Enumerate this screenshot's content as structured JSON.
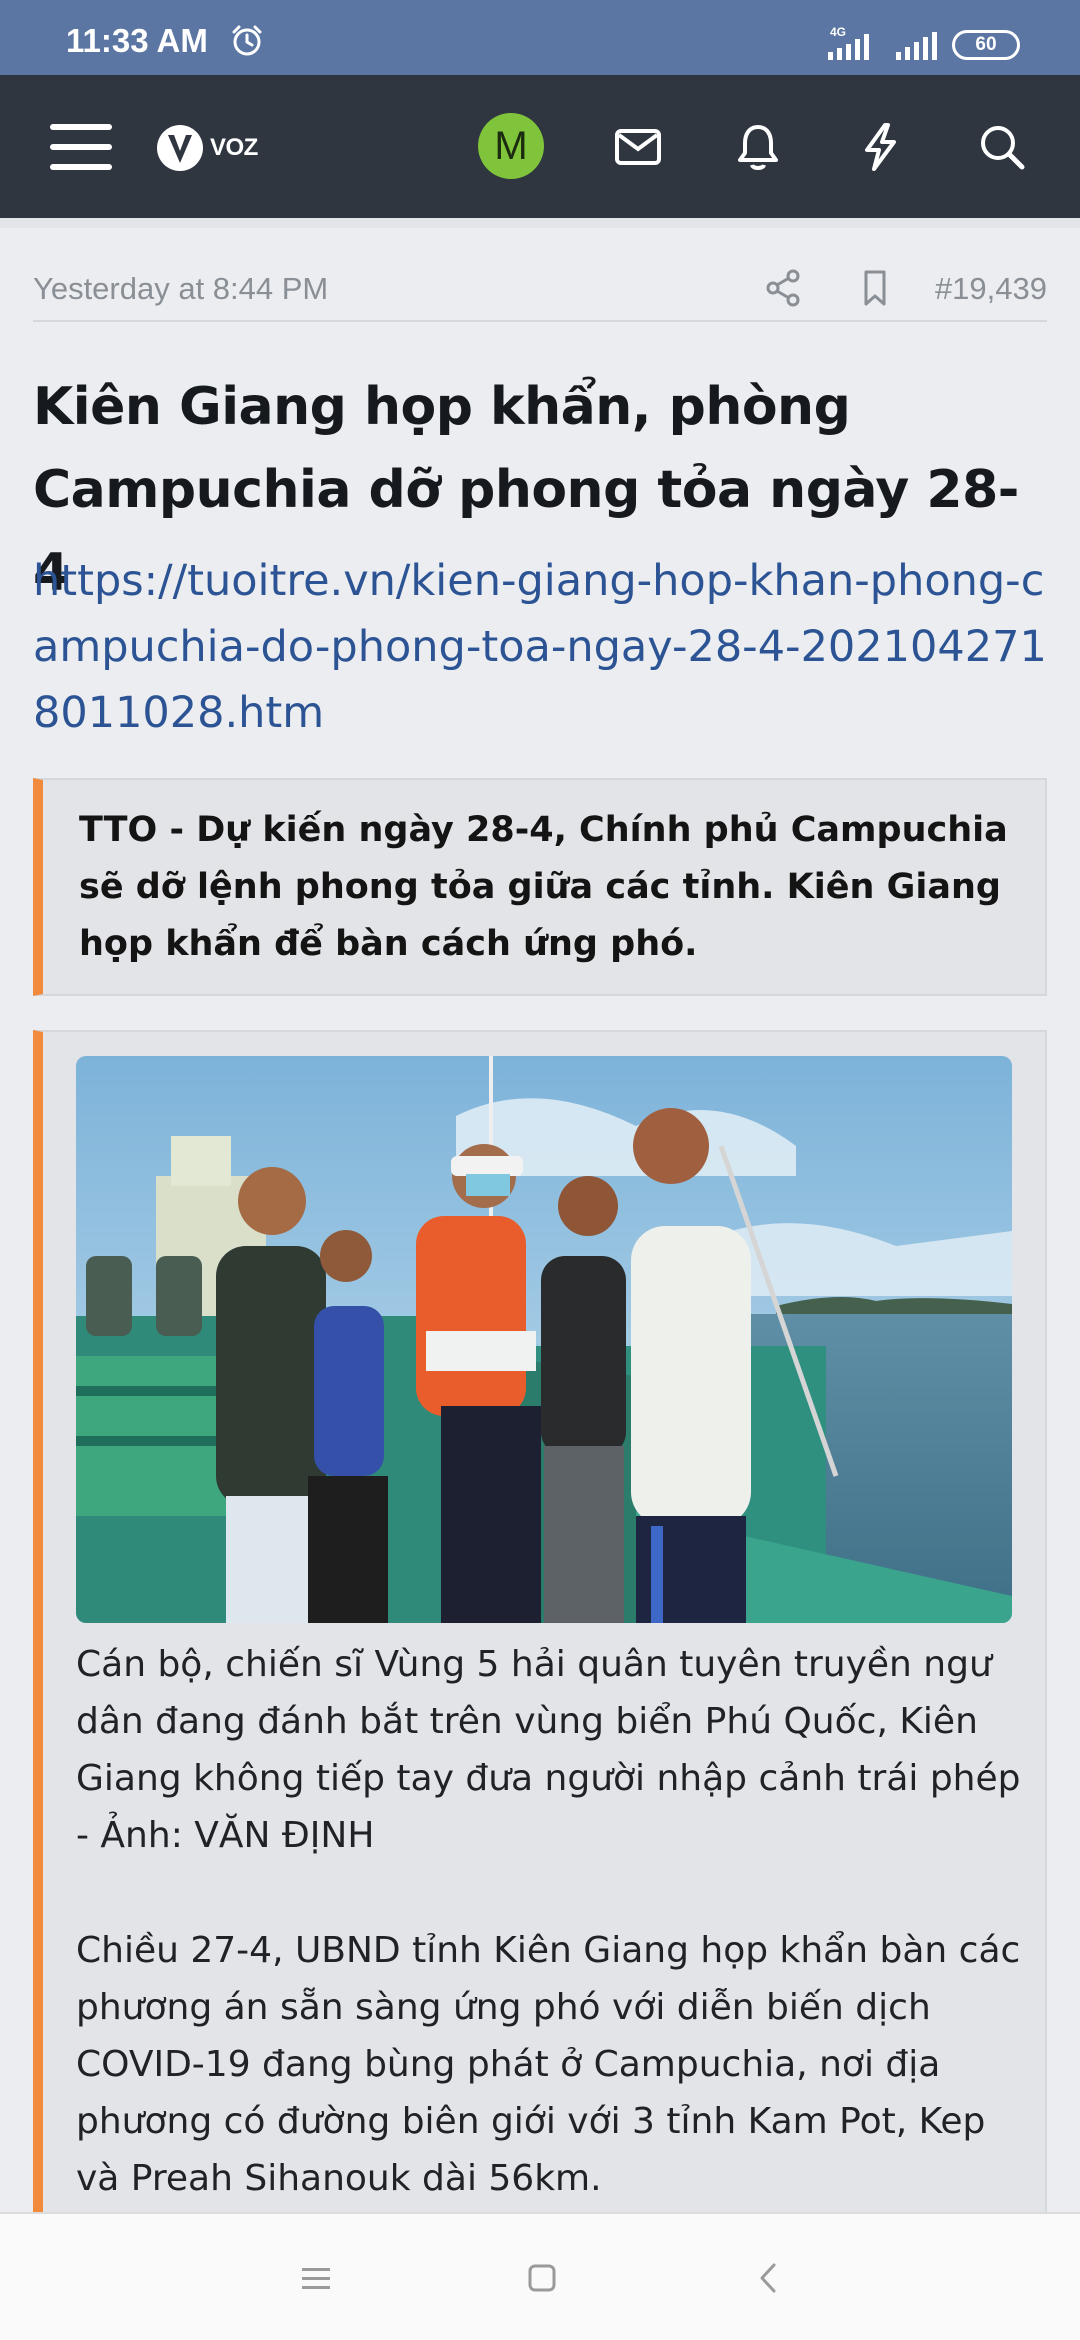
{
  "status_bar": {
    "time": "11:33 AM",
    "network_label": "4G",
    "battery": "60",
    "icons": [
      "alarm-icon",
      "signal-4g-icon",
      "signal-icon",
      "battery-icon"
    ]
  },
  "header": {
    "logo_text": "VOZ",
    "avatar_letter": "M",
    "colors": {
      "bar": "#2f3640",
      "avatar": "#7fc43a",
      "status": "#5c76a3"
    },
    "icons": [
      "menu-icon",
      "voz-logo-icon",
      "mail-icon",
      "bell-icon",
      "bolt-icon",
      "search-icon"
    ]
  },
  "post": {
    "date": "Yesterday at 8:44 PM",
    "number": "#19,439",
    "title": "Kiên Giang họp khẩn, phòng Campuchia dỡ phong tỏa ngày 28-4",
    "link": "https://tuoitre.vn/kien-giang-hop-khan-phong-campuchia-do-phong-toa-ngay-28-4-2021042718011028.htm",
    "lead": "TTO - Dự kiến ngày 28-4, Chính phủ Campuchia sẽ dỡ lệnh phong tỏa giữa các tỉnh. Kiên Giang họp khẩn để bàn cách ứng phó.",
    "caption": "Cán bộ, chiến sĩ Vùng 5 hải quân tuyên truyền ngư dân đang đánh bắt trên vùng biển Phú Quốc, Kiên Giang không tiếp tay đưa người nhập cảnh trái phép - Ảnh: VĂN ĐỊNH",
    "paragraph": "Chiều 27-4, UBND tỉnh Kiên Giang họp khẩn bàn các phương án sẵn sàng ứng phó với diễn biến dịch COVID-19 đang bùng phát ở Campuchia, nơi địa phương có đường biên giới với 3 tỉnh Kam Pot, Kep và Preah Sihanouk dài 56km.",
    "colors": {
      "quote_border": "#f28a3e",
      "link": "#2c5494"
    }
  },
  "navigation": {
    "icons": [
      "recents-icon",
      "home-icon",
      "back-icon"
    ]
  }
}
